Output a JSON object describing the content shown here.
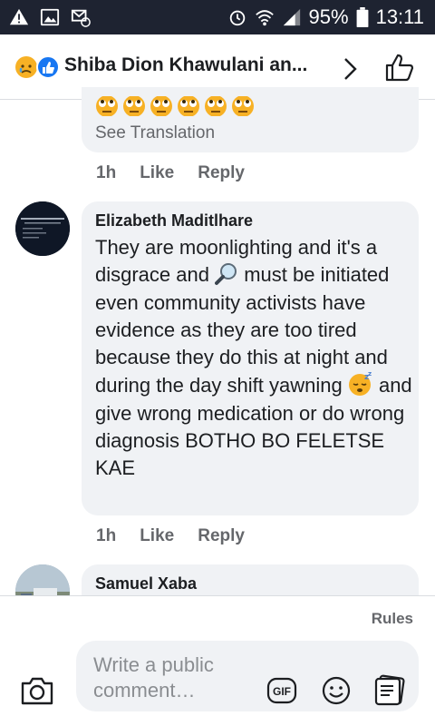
{
  "status_bar": {
    "battery": "95%",
    "time": "13:11"
  },
  "header": {
    "title": "Shiba Dion Khawulani an...",
    "reactions": [
      "sad-react",
      "like-react"
    ]
  },
  "comments": [
    {
      "emoji_icons": [
        "rolling-eyes",
        "rolling-eyes",
        "rolling-eyes",
        "rolling-eyes",
        "rolling-eyes",
        "rolling-eyes"
      ],
      "see_translation": "See Translation",
      "time": "1h",
      "like_label": "Like",
      "reply_label": "Reply"
    },
    {
      "author": "Elizabeth Maditlhare",
      "text_part1": "They are moonlighting and it's a disgrace and ",
      "text_part2": " must be initiated even community activists have evidence as they are too tired because they do this at night and during the day shift yawning ",
      "text_part3": " and give wrong medication or do wrong diagnosis BOTHO BO FELETSE KAE",
      "inline_icons": [
        "magnifying-glass",
        "sleepy-face"
      ],
      "time": "1h",
      "like_label": "Like",
      "reply_label": "Reply"
    },
    {
      "author": "Samuel Xaba"
    }
  ],
  "composer": {
    "rules_label": "Rules",
    "placeholder": "Write a public comment…"
  }
}
